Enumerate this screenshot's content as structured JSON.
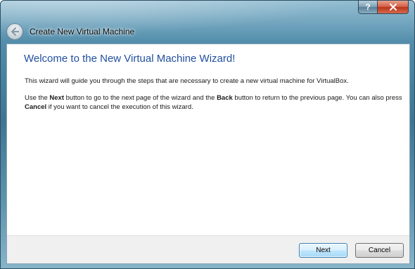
{
  "window": {
    "title": "Create New Virtual Machine",
    "help_glyph": "?",
    "close_icon": "close-icon",
    "back_icon": "back-arrow-icon"
  },
  "page": {
    "heading": "Welcome to the New Virtual Machine Wizard!",
    "intro": "This wizard will guide you through the steps that are necessary to create a new virtual machine for VirtualBox.",
    "instructions": {
      "part1": "Use the ",
      "next_word": "Next",
      "part2": " button to go to the next page of the wizard and the ",
      "back_word": "Back",
      "part3": " button to return to the previous page. You can also press ",
      "cancel_word": "Cancel",
      "part4": " if you want to cancel the execution of this wizard."
    }
  },
  "buttons": {
    "next_label": "Next",
    "cancel_label": "Cancel"
  },
  "colors": {
    "heading": "#1f4e9e",
    "close_button": "#c8442a",
    "frame": "#4f8aa8"
  }
}
